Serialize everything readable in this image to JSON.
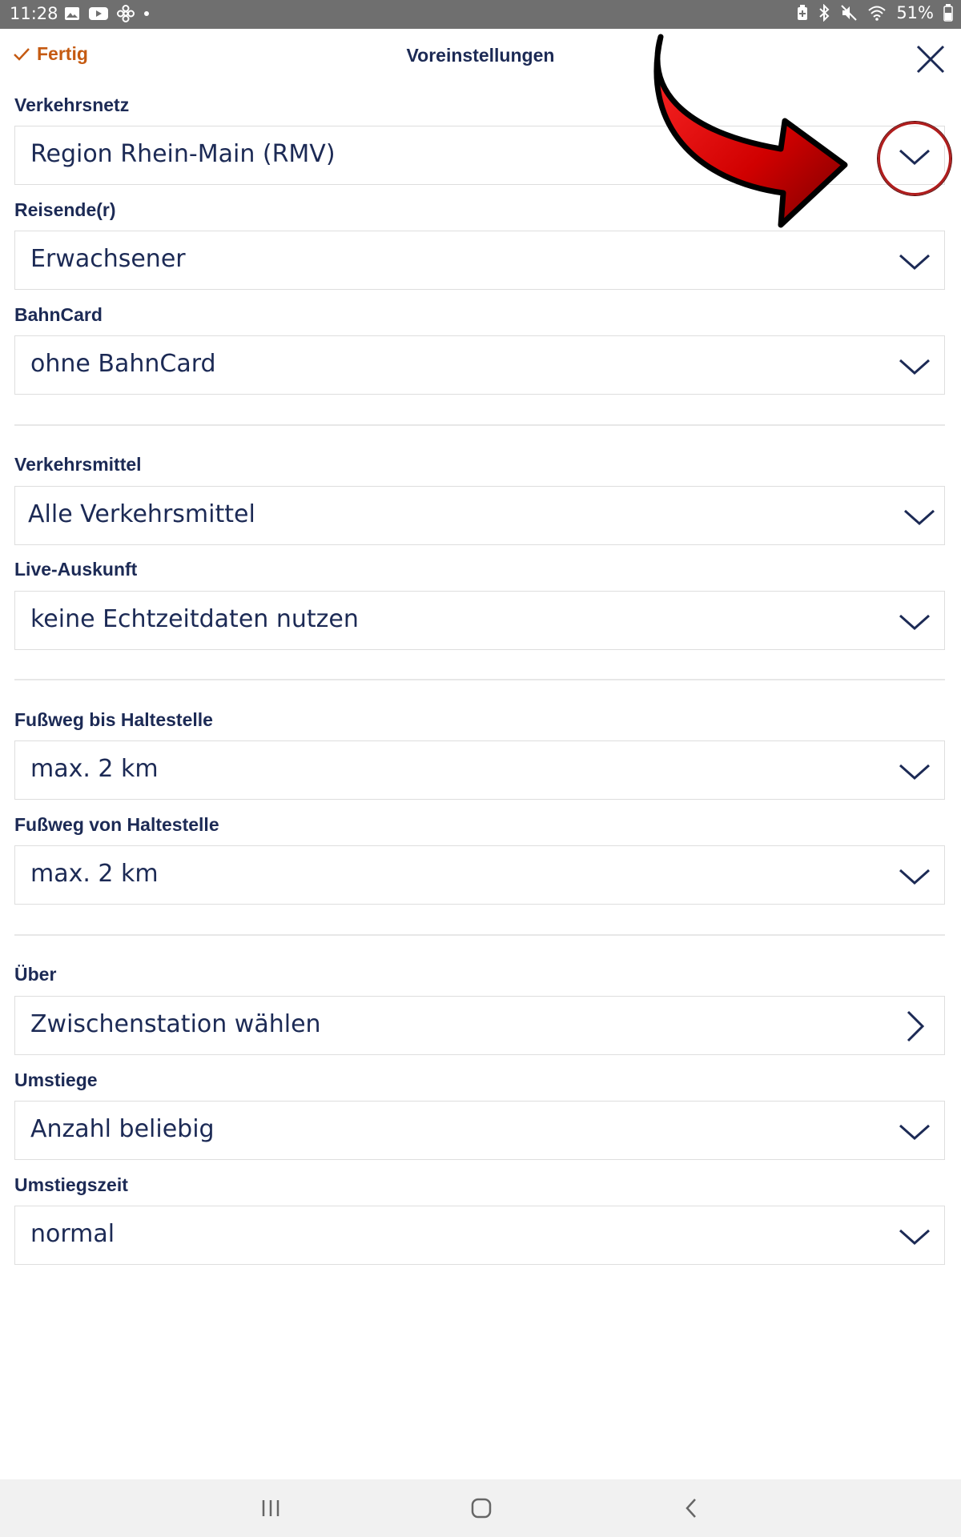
{
  "status_bar": {
    "time": "11:28",
    "battery": "51%",
    "left_icons": [
      "image-icon",
      "youtube-icon",
      "fan-icon",
      "dot-icon"
    ],
    "right_icons": [
      "battery-saver-icon",
      "bluetooth-icon",
      "mute-icon",
      "wifi-icon",
      "battery-icon"
    ]
  },
  "header": {
    "done_label": "Fertig",
    "title": "Voreinstellungen"
  },
  "sections": {
    "verkehrsnetz": {
      "label": "Verkehrsnetz",
      "value": "Region Rhein-Main (RMV)"
    },
    "reisende": {
      "label": "Reisende(r)",
      "value": "Erwachsener"
    },
    "bahncard": {
      "label": "BahnCard",
      "value": "ohne BahnCard"
    },
    "verkehrsmittel": {
      "label": "Verkehrsmittel",
      "value": "Alle Verkehrsmittel"
    },
    "live": {
      "label": "Live-Auskunft",
      "value": "keine Echtzeitdaten nutzen"
    },
    "fussweg_bis": {
      "label": "Fußweg bis Haltestelle",
      "value": "max. 2 km"
    },
    "fussweg_von": {
      "label": "Fußweg von Haltestelle",
      "value": "max. 2 km"
    },
    "ueber": {
      "label": "Über",
      "value": "Zwischenstation wählen"
    },
    "umstiege": {
      "label": "Umstiege",
      "value": "Anzahl beliebig"
    },
    "umstiegszeit": {
      "label": "Umstiegszeit",
      "value": "normal"
    }
  },
  "colors": {
    "accent_orange": "#c55a11",
    "text_navy": "#1c2a55",
    "annotation_red": "#d40000"
  },
  "icons": {
    "done": "checkmark-icon",
    "close": "close-icon",
    "dropdown": "chevron-down-icon",
    "forward": "chevron-right-icon",
    "nav": [
      "recent-apps-icon",
      "home-icon",
      "back-icon"
    ]
  }
}
